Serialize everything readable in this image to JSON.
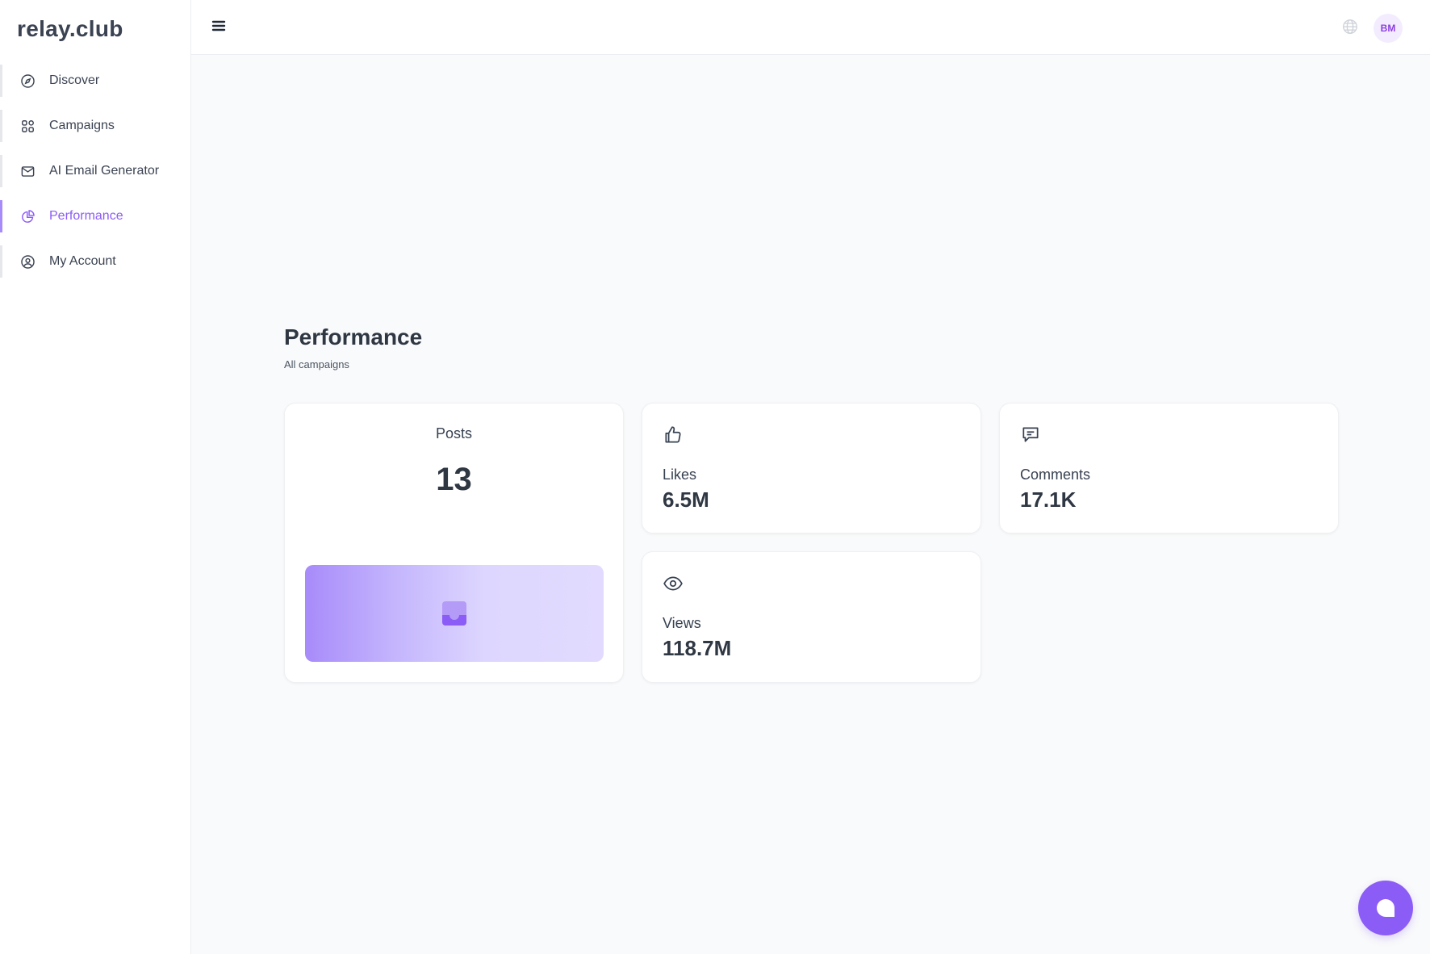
{
  "app": {
    "logo": "relay.club"
  },
  "sidebar": {
    "items": [
      {
        "label": "Discover",
        "icon": "compass-icon"
      },
      {
        "label": "Campaigns",
        "icon": "grid-icon"
      },
      {
        "label": "AI Email Generator",
        "icon": "mail-icon"
      },
      {
        "label": "Performance",
        "icon": "pie-chart-icon",
        "active": true
      },
      {
        "label": "My Account",
        "icon": "user-circle-icon"
      }
    ]
  },
  "header": {
    "menu_icon": "hamburger-menu-icon",
    "language_icon": "globe-icon",
    "avatar_initials": "BM"
  },
  "main": {
    "title": "Performance",
    "subtitle": "All campaigns",
    "posts": {
      "label": "Posts",
      "value": "13",
      "image_icon": "inbox-icon"
    },
    "likes": {
      "label": "Likes",
      "value": "6.5M",
      "icon": "thumbs-up-icon"
    },
    "comments": {
      "label": "Comments",
      "value": "17.1K",
      "icon": "message-square-icon"
    },
    "views": {
      "label": "Views",
      "value": "118.7M",
      "icon": "eye-icon"
    }
  },
  "colors": {
    "accent": "#8b5cf6",
    "text": "#374151",
    "background": "#f9fafb"
  },
  "chat_widget": {
    "icon": "chat-bubble-icon"
  }
}
